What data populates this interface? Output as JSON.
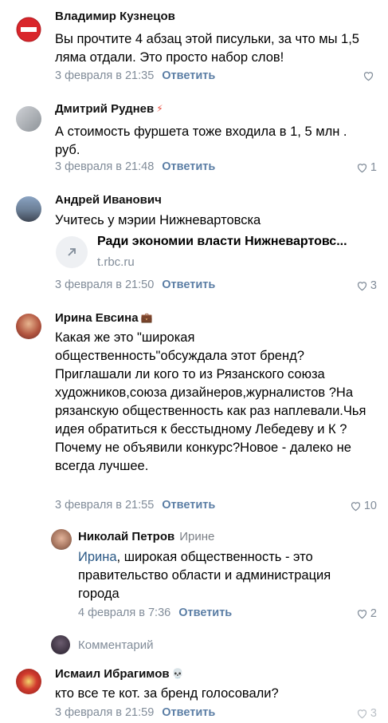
{
  "comments": [
    {
      "author": "Владимир Кузнецов",
      "badge": "",
      "text": "Вы прочтите 4 абзац этой писульки, за что мы 1,5 ляма отдали. Это просто набор слов!",
      "date": "3 февраля в 21:35",
      "reply_label": "Ответить",
      "likes": ""
    },
    {
      "author": "Дмитрий Руднев",
      "badge": "⚡",
      "text": "А стоимость фуршета тоже входила в 1, 5 млн . руб.",
      "date": "3 февраля в 21:48",
      "reply_label": "Ответить",
      "likes": "1"
    },
    {
      "author": "Андрей Иванович",
      "badge": "",
      "text": "Учитесь у мэрии Нижневартовска",
      "link_title": "Ради экономии власти Нижневартовс...",
      "link_domain": "t.rbc.ru",
      "date": "3 февраля в 21:50",
      "reply_label": "Ответить",
      "likes": "3"
    },
    {
      "author": "Ирина Евсина",
      "badge": "💼",
      "text": "Какая же это \"широкая общественность\"обсуждала этот бренд?Приглашали ли  кого то из Рязанского союза художников,союза дизайнеров,журналистов ?На рязанскую общественность как раз наплевали.Чья идея обратиться к бесстыдному Лебедеву и К ? Почему не объявили конкурс?Новое - далеко не всегда лучшее.",
      "date": "3 февраля в 21:55",
      "reply_label": "Ответить",
      "likes": "10"
    },
    {
      "author": "Николай Петров",
      "reply_to": "Ирине",
      "mention": "Ирина",
      "text": ", широкая общественность - это правительство области и администрация города",
      "date": "4 февраля в 7:36",
      "reply_label": "Ответить",
      "likes": "2"
    },
    {
      "author": "Исмаил Ибрагимов",
      "badge": "💀",
      "text": "кто все те кот. за бренд голосовали?",
      "date": "3 февраля в 21:59",
      "reply_label": "Ответить",
      "likes": "3"
    }
  ],
  "write_comment": {
    "placeholder": "Комментарий"
  },
  "colors": {
    "link": "#2a5885",
    "meta": "#818c99",
    "reply": "#5b7ea5"
  }
}
